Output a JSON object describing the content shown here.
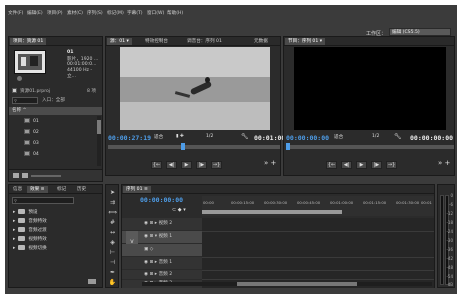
{
  "menu": [
    "文件(F)",
    "编辑(E)",
    "项目(P)",
    "素材(C)",
    "序列(S)",
    "标记(M)",
    "字幕(T)",
    "窗口(W)",
    "帮助(H)"
  ],
  "workspace": {
    "label": "工作区：",
    "value": "编辑 (CS5.5)"
  },
  "project": {
    "tabs": [
      "项目：资源 01",
      "≡"
    ],
    "item_name": "01",
    "item_info": [
      "影片，1920 ...",
      "00:01:00:0...",
      "44100 Hz - 立..."
    ],
    "file": "资源01.prproj",
    "count": "8 项",
    "search_icon": "search-icon",
    "entry_label": "入口：全部",
    "list_header": "名称 ^",
    "items": [
      "01",
      "02",
      "03",
      "04"
    ]
  },
  "source": {
    "tabs": [
      "源：01 ▾",
      "特效控制台",
      "调音台：序列 01",
      "元数据"
    ],
    "timecode_left": "00:00:27:19",
    "fit": "适合",
    "ratio": "1/2",
    "timecode_right": "00:01:00",
    "controls": [
      "{←",
      "◀|",
      "▶",
      "|▶",
      "→}"
    ]
  },
  "program": {
    "tabs": [
      "节目：序列 01 ▾"
    ],
    "timecode_left": "00:00:00:00",
    "fit": "适合",
    "ratio": "1/2",
    "timecode_right": "00:00:00:00",
    "controls": [
      "{←",
      "◀|",
      "▶",
      "|▶",
      "→}"
    ]
  },
  "effects": {
    "tabs": [
      "信息",
      "效果 ≡",
      "标记",
      "历史"
    ],
    "folders": [
      "预设",
      "音频特效",
      "音频过渡",
      "视频特效",
      "视频切换"
    ]
  },
  "timeline": {
    "tabs": [
      "序列 01 ≡"
    ],
    "timecode": "00:00:00:00",
    "ruler": [
      "00:00",
      "00:00:15:00",
      "00:00:30:00",
      "00:00:45:00",
      "00:01:00:00",
      "00:01:15:00",
      "00:01:30:00",
      "00:01"
    ],
    "tracks": [
      {
        "side": "",
        "label": "视频 2"
      },
      {
        "side": "V",
        "label": "视频 1"
      },
      {
        "side": "A1",
        "label": "音频 1"
      },
      {
        "side": "",
        "label": "音频 2"
      },
      {
        "side": "",
        "label": "音频 3"
      }
    ]
  },
  "meter_ticks": [
    "0",
    "-6",
    "-12",
    "-18",
    "-24",
    "-30",
    "-36",
    "-42",
    "-48",
    "-54",
    "dB"
  ],
  "colors": {
    "accent": "#4e9de8",
    "panel": "#2b2b2b",
    "bg": "#3b3b3b"
  }
}
